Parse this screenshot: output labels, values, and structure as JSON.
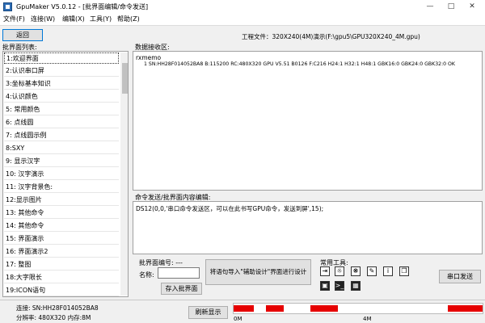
{
  "window": {
    "title": "GpuMaker V5.0.12 - [批界面编辑/命令发送]"
  },
  "menu": [
    "文件(F)",
    "连接(W)",
    "编辑(X)",
    "工具(Y)",
    "帮助(Z)"
  ],
  "toolbar": {
    "back_label": "返回",
    "project_file": "工程文件：320X240(4M)演示(F:\\gpu5\\GPU320X240_4M.gpu)"
  },
  "sidebar": {
    "header": "批界面列表:",
    "items": [
      "1:欢迎界面",
      "2:认识串口屏",
      "3:坐标基本知识",
      "4:认识颜色",
      "5: 常用颜色",
      "6: 点线圆",
      "7: 点线圆示例",
      "8:SXY",
      "9: 显示汉字",
      "10: 汉字演示",
      "11: 汉字背景色:",
      "12:显示图片",
      "13: 其他命令",
      "14: 其他命令",
      "15: 界面演示",
      "16: 界面演示2",
      "17: 整图",
      "18:大字限长",
      "19:ICON语句"
    ]
  },
  "receive": {
    "label": "数据接收区:",
    "line1": "rxmemo",
    "line2": "1  SN:HH28F014052BA8 B:115200 RC:480X320 GPU V5.51 B0126 F:C216 H24:1 H32:1 H48:1 GBK16:0 GBK24:0 GBK32:0 OK"
  },
  "command": {
    "label": "命令发送/批界面内容编辑:",
    "text": "DS12(0,0,'串口命令发送区，可以在此书写GPU命令，发送到屏',15);"
  },
  "batch": {
    "number_label": "批界面编号: ---",
    "name_label": "名称:",
    "name_value": "",
    "save_label": "存入批界面",
    "import_label": "将语句导入\"辅助设计\"界面进行设计"
  },
  "tools": {
    "label": "常用工具:",
    "icons": [
      "enter-icon",
      "brightness-icon",
      "settings-icon",
      "pen-icon",
      "info-icon",
      "copy-icon",
      "chip-icon",
      "terminal-icon",
      "keypad-icon"
    ]
  },
  "serial_send_label": "串口发送",
  "status": {
    "connection": "连接: SN:HH28F014052BA8",
    "resolution": "分辨率: 480X320  内存:8M",
    "refresh_label": "刷新显示",
    "mem_label_0": "0M",
    "mem_label_1": "4M",
    "mem_used": [
      [
        0.0,
        0.08
      ],
      [
        0.13,
        0.2
      ],
      [
        0.31,
        0.42
      ],
      [
        0.86,
        1.0
      ]
    ],
    "mem_color": "#e60000"
  }
}
